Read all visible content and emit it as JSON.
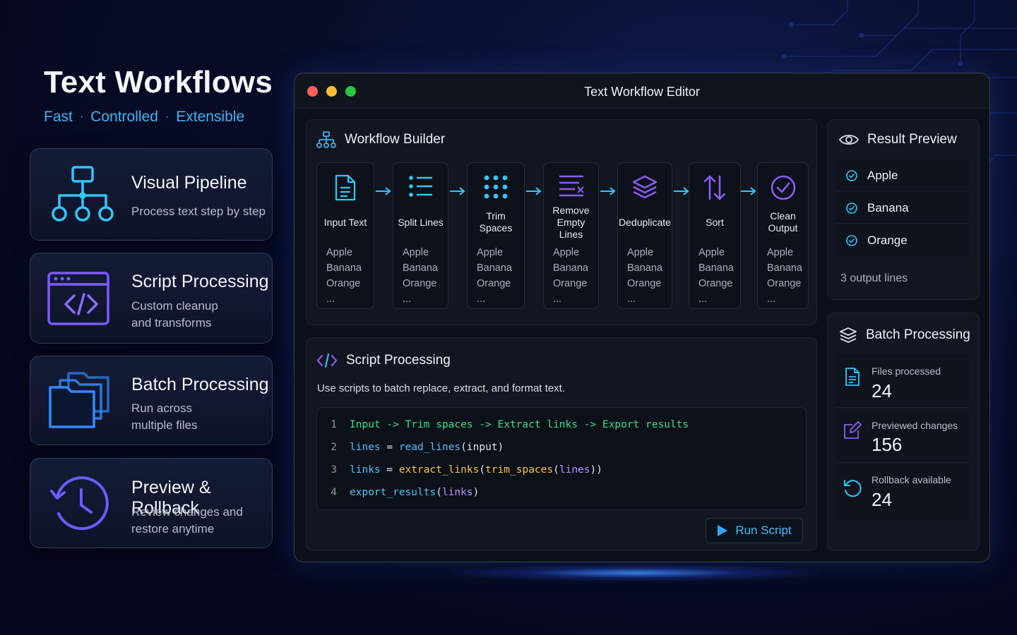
{
  "hero": {
    "title": "Text Workflows",
    "tagline": [
      "Fast",
      "Controlled",
      "Extensible"
    ]
  },
  "features": [
    {
      "title": "Visual Pipeline",
      "desc": "Process text step by step",
      "icon": "pipeline-icon"
    },
    {
      "title": "Script Processing",
      "desc": "Custom cleanup and transforms",
      "icon": "code-window-icon"
    },
    {
      "title": "Batch Processing",
      "desc": "Run across multiple files",
      "icon": "folders-icon"
    },
    {
      "title": "Preview & Rollback",
      "desc": "Review changes and restore anytime",
      "icon": "history-clock-icon"
    }
  ],
  "window": {
    "title": "Text Workflow Editor"
  },
  "builder": {
    "title": "Workflow Builder",
    "steps": [
      {
        "label": "Input Text",
        "icon": "document-icon",
        "items": [
          "Apple",
          "Banana",
          "Orange",
          "..."
        ]
      },
      {
        "label": "Split Lines",
        "icon": "list-icon",
        "items": [
          "Apple",
          "Banana",
          "Orange",
          "..."
        ]
      },
      {
        "label": "Trim Spaces",
        "icon": "dots-grid-icon",
        "items": [
          "Apple",
          "Banana",
          "Orange",
          "..."
        ]
      },
      {
        "label": "Remove Empty Lines",
        "icon": "remove-lines-icon",
        "items": [
          "Apple",
          "Banana",
          "Orange",
          "..."
        ]
      },
      {
        "label": "Deduplicate",
        "icon": "layers-icon",
        "items": [
          "Apple",
          "Banana",
          "Orange",
          "..."
        ]
      },
      {
        "label": "Sort",
        "icon": "sort-arrows-icon",
        "items": [
          "Apple",
          "Banana",
          "Orange",
          "..."
        ]
      },
      {
        "label": "Clean Output",
        "icon": "check-circle-icon",
        "items": [
          "Apple",
          "Banana",
          "Orange",
          "..."
        ]
      }
    ]
  },
  "script": {
    "title": "Script Processing",
    "description": "Use scripts to batch replace, extract, and format text.",
    "lines": [
      {
        "n": "1",
        "tokens": [
          {
            "t": "Input -> Trim spaces -> Extract links -> Export results",
            "c": "green"
          }
        ]
      },
      {
        "n": "2",
        "tokens": [
          {
            "t": "lines",
            "c": "blue"
          },
          {
            "t": " = ",
            "c": "plain"
          },
          {
            "t": "read_lines",
            "c": "blue"
          },
          {
            "t": "(input)",
            "c": "plain"
          }
        ]
      },
      {
        "n": "3",
        "tokens": [
          {
            "t": "links",
            "c": "blue"
          },
          {
            "t": " = ",
            "c": "plain"
          },
          {
            "t": "extract_links",
            "c": "yellow"
          },
          {
            "t": "(",
            "c": "plain"
          },
          {
            "t": "trim_spaces",
            "c": "yellow"
          },
          {
            "t": "(",
            "c": "plain"
          },
          {
            "t": "lines",
            "c": "purple"
          },
          {
            "t": "))",
            "c": "plain"
          }
        ]
      },
      {
        "n": "4",
        "tokens": [
          {
            "t": "export_results",
            "c": "blue"
          },
          {
            "t": "(",
            "c": "plain"
          },
          {
            "t": "links",
            "c": "purple"
          },
          {
            "t": ")",
            "c": "plain"
          }
        ]
      }
    ],
    "run_label": "Run Script"
  },
  "result": {
    "title": "Result Preview",
    "items": [
      "Apple",
      "Banana",
      "Orange"
    ],
    "footer": "3 output lines"
  },
  "batch": {
    "title": "Batch Processing",
    "stats": [
      {
        "label": "Files processed",
        "value": "24",
        "icon": "file-icon"
      },
      {
        "label": "Previewed changes",
        "value": "156",
        "icon": "edit-icon"
      },
      {
        "label": "Rollback available",
        "value": "24",
        "icon": "rollback-icon"
      }
    ]
  },
  "colors": {
    "accent": "#3ab6f5",
    "purple": "#8b5cf6",
    "green": "#35e08f",
    "yellow": "#f5c542"
  }
}
